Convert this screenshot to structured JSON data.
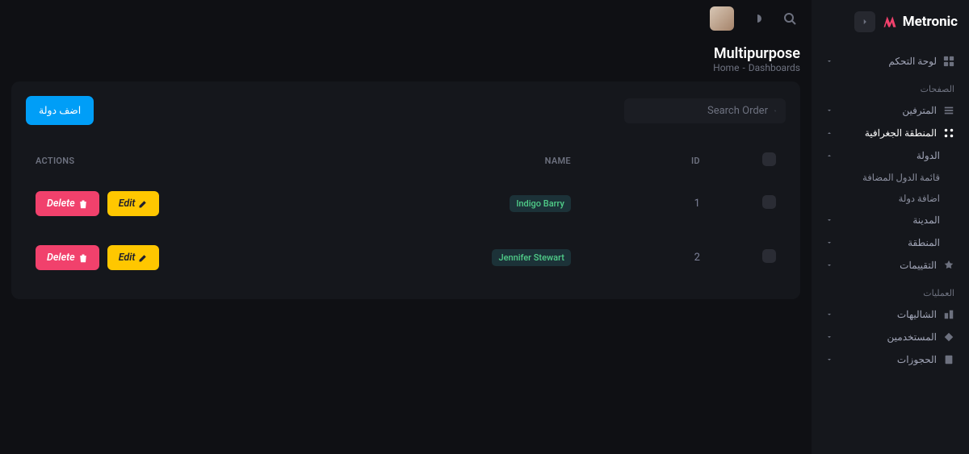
{
  "brand": {
    "name": "Metronic"
  },
  "sidebar": {
    "dashboard_label": "لوحة التحكم",
    "section_pages": "الصفحات",
    "items": {
      "translators": "المترفين",
      "geo": "المنطقة الجغرافية",
      "country": "الدولة",
      "country_list": "قائمة الدول المضافة",
      "country_add": "اضافة دولة",
      "city": "المدينة",
      "area": "المنطقة",
      "ratings": "التقييمات"
    },
    "section_ops": "العمليات",
    "ops": {
      "chalets": "الشاليهات",
      "users": "المستخدمين",
      "bookings": "الحجوزات"
    }
  },
  "page": {
    "title": "Multipurpose",
    "crumb_home": "Home",
    "crumb_dash": "Dashboards"
  },
  "card": {
    "add_btn": "اضف دولة",
    "search_placeholder": "Search Order"
  },
  "table": {
    "headers": {
      "id": "ID",
      "name": "NAME",
      "actions": "ACTIONS"
    },
    "rows": [
      {
        "id": "1",
        "name": "Indigo Barry"
      },
      {
        "id": "2",
        "name": "Jennifer Stewart"
      }
    ],
    "edit_label": "Edit",
    "delete_label": "Delete"
  }
}
